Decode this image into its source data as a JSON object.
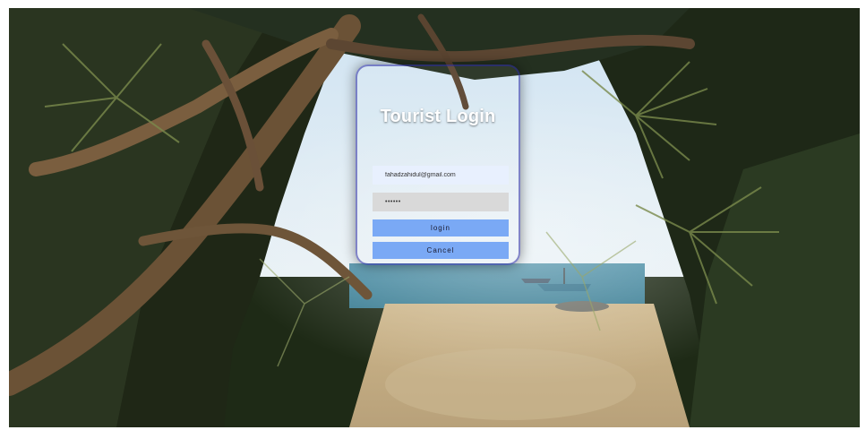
{
  "login": {
    "title": "Tourist Login",
    "email_value": "fahadzahidul@gmail.com",
    "password_value": "••••••",
    "login_label": "login",
    "cancel_label": "Cancel"
  },
  "colors": {
    "button": "#7aa9f5",
    "email_field_bg": "#e8f0fe",
    "password_field_bg": "#d9d9d9",
    "card_border": "#2828a0"
  }
}
